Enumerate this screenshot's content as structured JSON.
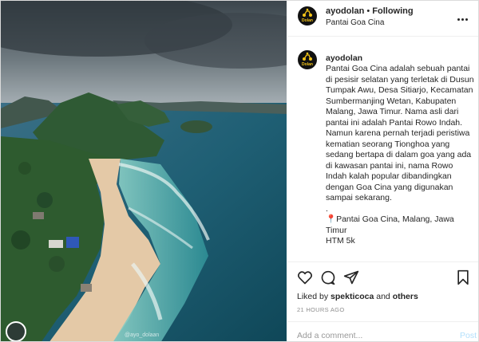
{
  "post": {
    "username": "ayodolan",
    "separator": "•",
    "follow_status": "Following",
    "location": "Pantai Goa Cina",
    "avatar_badge": "Dolan",
    "caption": "Pantai Goa Cina adalah sebuah pantai di pesisir selatan yang terletak di Dusun Tumpak Awu, Desa Sitiarjo, Kecamatan Sumbermanjing Wetan, Kabupaten Malang, Jawa Timur. Nama asli dari pantai ini adalah Pantai Rowo Indah. Namun karena pernah terjadi peristiwa kematian seorang Tionghoa yang sedang bertapa di dalam goa yang ada di kawasan pantai ini, nama Rowo Indah kalah popular dibandingkan dengan Goa Cina yang digunakan sampai sekarang.\n.",
    "caption_location_pin": "📍",
    "caption_location": "Pantai Goa Cina, Malang, Jawa Timur",
    "caption_cutoff": "HTM 5k",
    "photo_credit": "@ayo_dolaan"
  },
  "actions": {
    "liked_by_prefix": "Liked by",
    "liked_by_user": "spekticoca",
    "liked_by_suffix": "and",
    "liked_by_others": "others",
    "timestamp": "21 HOURS AGO",
    "comment_placeholder": "Add a comment...",
    "post_button": "Post"
  },
  "icons": [
    "heart-icon",
    "comment-icon",
    "share-icon",
    "bookmark-icon",
    "more-icon"
  ],
  "colors": {
    "text": "#262626",
    "muted": "#8e8e8e",
    "post_button": "#b2dffc",
    "border": "#dbdbdb"
  }
}
